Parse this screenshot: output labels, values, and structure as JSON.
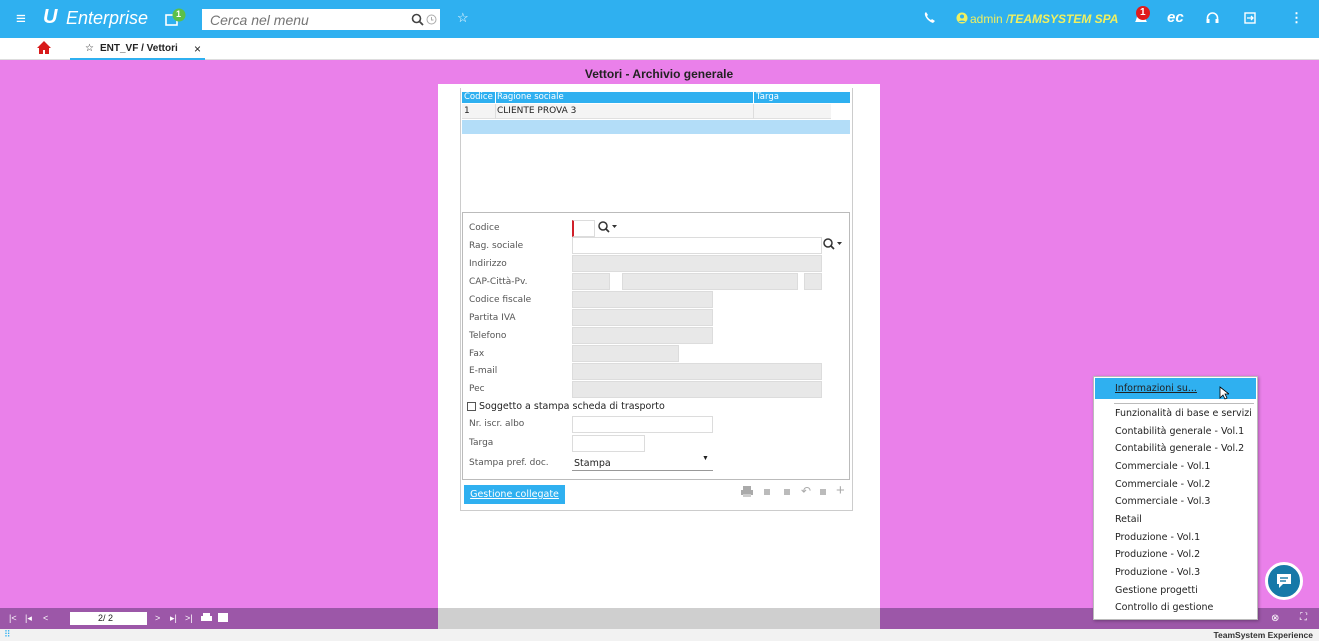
{
  "topbar": {
    "menu_icon": "≡",
    "logo_mark": "U",
    "logo_text": "Enterprise",
    "notif_badge": "1",
    "search_placeholder": "Cerca nel menu",
    "star": "☆",
    "user_prefix": "admin /",
    "company": "TEAMSYSTEM SPA",
    "bell_badge": "1",
    "ec": "ec",
    "dots": "⋮"
  },
  "tabs": {
    "home_icon": "home-icon",
    "active_tab": "ENT_VF / Vettori",
    "close": "×"
  },
  "window": {
    "title": "Vettori - Archivio generale"
  },
  "grid": {
    "columns": [
      "Codice",
      "Ragione sociale",
      "Targa"
    ],
    "rows": [
      {
        "codice": "1",
        "ragione": "CLIENTE PROVA 3",
        "targa": ""
      }
    ]
  },
  "form": {
    "codice": "Codice",
    "rag_sociale": "Rag. sociale",
    "indirizzo": "Indirizzo",
    "cap": "CAP-Città-Pv.",
    "cf": "Codice fiscale",
    "piva": "Partita IVA",
    "telefono": "Telefono",
    "fax": "Fax",
    "email": "E-mail",
    "pec": "Pec",
    "checkbox": "Soggetto a stampa scheda di trasporto",
    "albo": "Nr. iscr. albo",
    "targa": "Targa",
    "stampa_label": "Stampa pref. doc.",
    "stampa_value": "Stampa",
    "button": "Gestione collegate"
  },
  "pager": {
    "value": "2/ 2"
  },
  "context_menu": {
    "items": [
      "Informazioni su...",
      "Funzionalità di base e servizi",
      "Contabilità generale - Vol.1",
      "Contabilità generale - Vol.2",
      "Commerciale - Vol.1",
      "Commerciale - Vol.2",
      "Commerciale - Vol.3",
      "Retail",
      "Produzione - Vol.1",
      "Produzione - Vol.2",
      "Produzione - Vol.3",
      "Gestione progetti",
      "Controllo di gestione"
    ]
  },
  "footer": {
    "brand": "TeamSystem Experience"
  },
  "colors": {
    "topbar": "#2fb0f0",
    "background": "#ea80ea",
    "grid_header": "#2fb0f0",
    "accent_yellow": "#f0f060",
    "badge_red": "#e01b1b",
    "bottombar": "#9c57a8"
  }
}
